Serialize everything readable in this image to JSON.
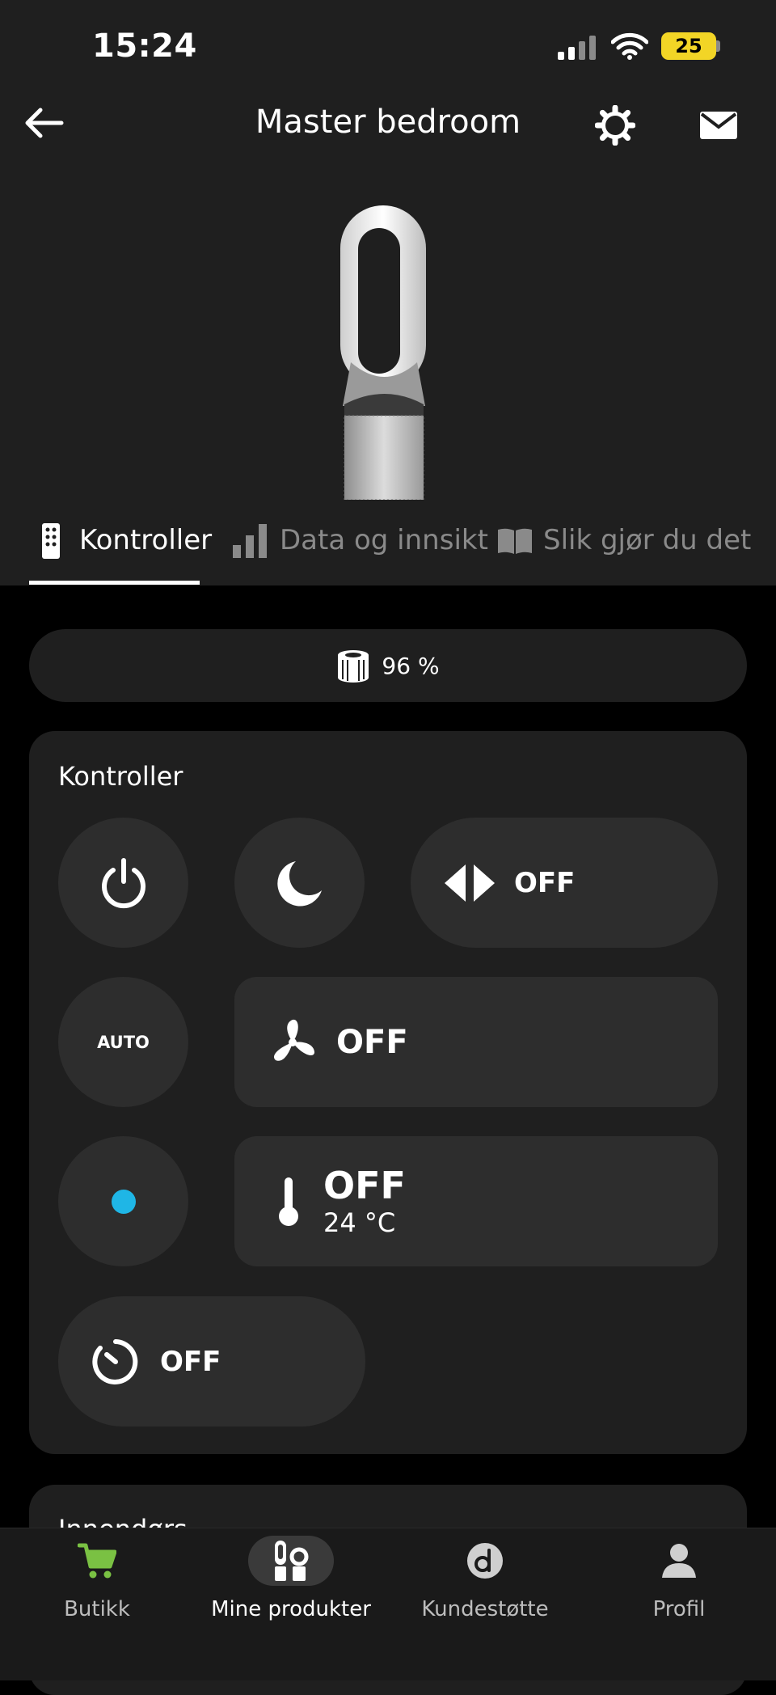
{
  "status_bar": {
    "time": "15:24",
    "battery": "25"
  },
  "header": {
    "title": "Master bedroom"
  },
  "tabs": [
    {
      "label": "Kontroller",
      "icon": "remote-icon",
      "active": true
    },
    {
      "label": "Data og innsikt",
      "icon": "bar-chart-icon",
      "active": false
    },
    {
      "label": "Slik gjør du det",
      "icon": "book-icon",
      "active": false
    }
  ],
  "filter": {
    "value": "96 %",
    "icon": "filter-icon"
  },
  "controls": {
    "title": "Kontroller",
    "oscillation_state": "OFF",
    "auto_label": "AUTO",
    "fan_state": "OFF",
    "heat_state": "OFF",
    "heat_target": "24 °C",
    "timer_state": "OFF",
    "indicator_color": "#1fb6e6"
  },
  "next_section": {
    "title": "Innendørs"
  },
  "bottom_nav": [
    {
      "label": "Butikk",
      "icon": "cart-icon",
      "active": false
    },
    {
      "label": "Mine produkter",
      "icon": "products-icon",
      "active": true
    },
    {
      "label": "Kundestøtte",
      "icon": "support-icon",
      "active": false
    },
    {
      "label": "Profil",
      "icon": "profile-icon",
      "active": false
    }
  ],
  "colors": {
    "accent_green": "#7ac143",
    "battery_yellow": "#f2d526"
  }
}
